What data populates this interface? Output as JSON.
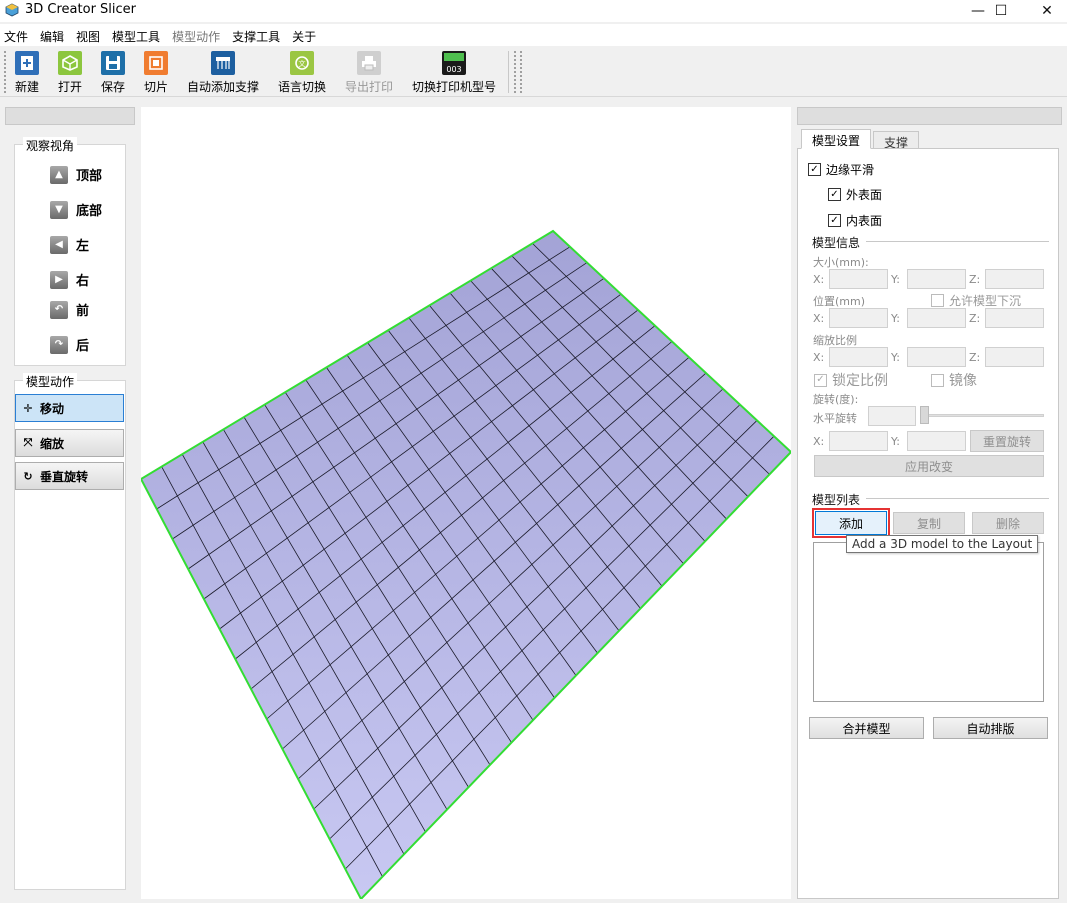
{
  "window": {
    "title": "3D Creator Slicer",
    "minimize": "—",
    "maximize": "☐",
    "close": "✕"
  },
  "menu": [
    "文件",
    "编辑",
    "视图",
    "模型工具",
    "模型动作",
    "支撑工具",
    "关于"
  ],
  "toolbar": {
    "new": "新建",
    "open": "打开",
    "save": "保存",
    "slice": "切片",
    "auto_support": "自动添加支撑",
    "language": "语言切换",
    "export_print": "导出打印",
    "switch_printer": "切换打印机型号",
    "printer_badge": "003"
  },
  "left": {
    "view_group": "观察视角",
    "views": [
      "顶部",
      "底部",
      "左",
      "右",
      "前",
      "后"
    ],
    "action_group": "模型动作",
    "actions": [
      "移动",
      "缩放",
      "垂直旋转"
    ]
  },
  "right": {
    "tabs": [
      "模型设置",
      "支撑"
    ],
    "edge_smooth": "边缘平滑",
    "outer_surface": "外表面",
    "inner_surface": "内表面",
    "model_info": "模型信息",
    "size_label": "大小(mm):",
    "position_label": "位置(mm)",
    "allow_sink": "允许模型下沉",
    "scale_label": "缩放比例",
    "lock_ratio": "锁定比例",
    "mirror": "镜像",
    "rotation_label": "旋转(度):",
    "horizontal_rotation": "水平旋转",
    "axis_x": "X:",
    "axis_y": "Y:",
    "axis_z": "Z:",
    "reset_rotation": "重置旋转",
    "apply_changes": "应用改变",
    "model_list": "模型列表",
    "add": "添加",
    "copy": "复制",
    "delete": "删除",
    "tooltip": "Add a 3D model to the Layout",
    "merge": "合并模型",
    "auto_layout": "自动排版"
  },
  "colors": {
    "plate": "#a8a8dc",
    "plate_edge": "#33dd33",
    "grid_line": "#1a1a2a",
    "highlight": "#e53333"
  }
}
